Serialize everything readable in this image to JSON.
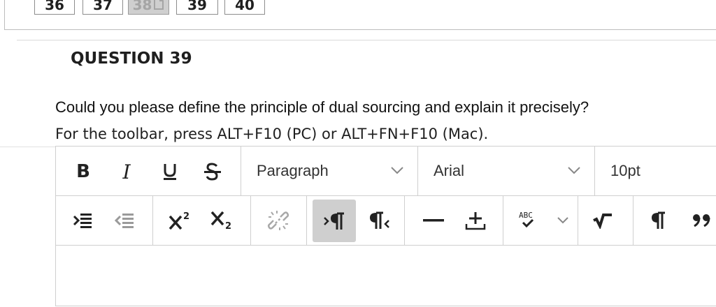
{
  "question_nav": {
    "numbers": [
      {
        "label": "36",
        "current": false
      },
      {
        "label": "37",
        "current": false
      },
      {
        "label": "38",
        "current": true
      },
      {
        "label": "39",
        "current": false
      },
      {
        "label": "40",
        "current": false
      }
    ]
  },
  "question": {
    "title": "QUESTION 39",
    "text": "Could you please define the principle of dual sourcing and explain it precisely?",
    "toolbar_hint": "For the toolbar, press ALT+F10 (PC) or ALT+FN+F10 (Mac)."
  },
  "editor": {
    "format_select": "Paragraph",
    "font_select": "Arial",
    "size_select": "10pt",
    "toolbar_row1": [
      "bold-icon",
      "italic-icon",
      "underline-icon",
      "strikethrough-icon"
    ],
    "toolbar_row2": [
      "indent-icon",
      "outdent-icon",
      "superscript-icon",
      "subscript-icon",
      "unlink-icon",
      "ltr-paragraph-icon",
      "rtl-paragraph-icon",
      "horizontal-line-icon",
      "plus-minus-icon",
      "spellcheck-icon",
      "math-icon",
      "paragraph-icon",
      "blockquote-icon"
    ],
    "body_text": ""
  },
  "colors": {
    "active_button_bg": "#cfcfcf",
    "border": "#cfcfcf",
    "text": "#1f1f1f"
  }
}
